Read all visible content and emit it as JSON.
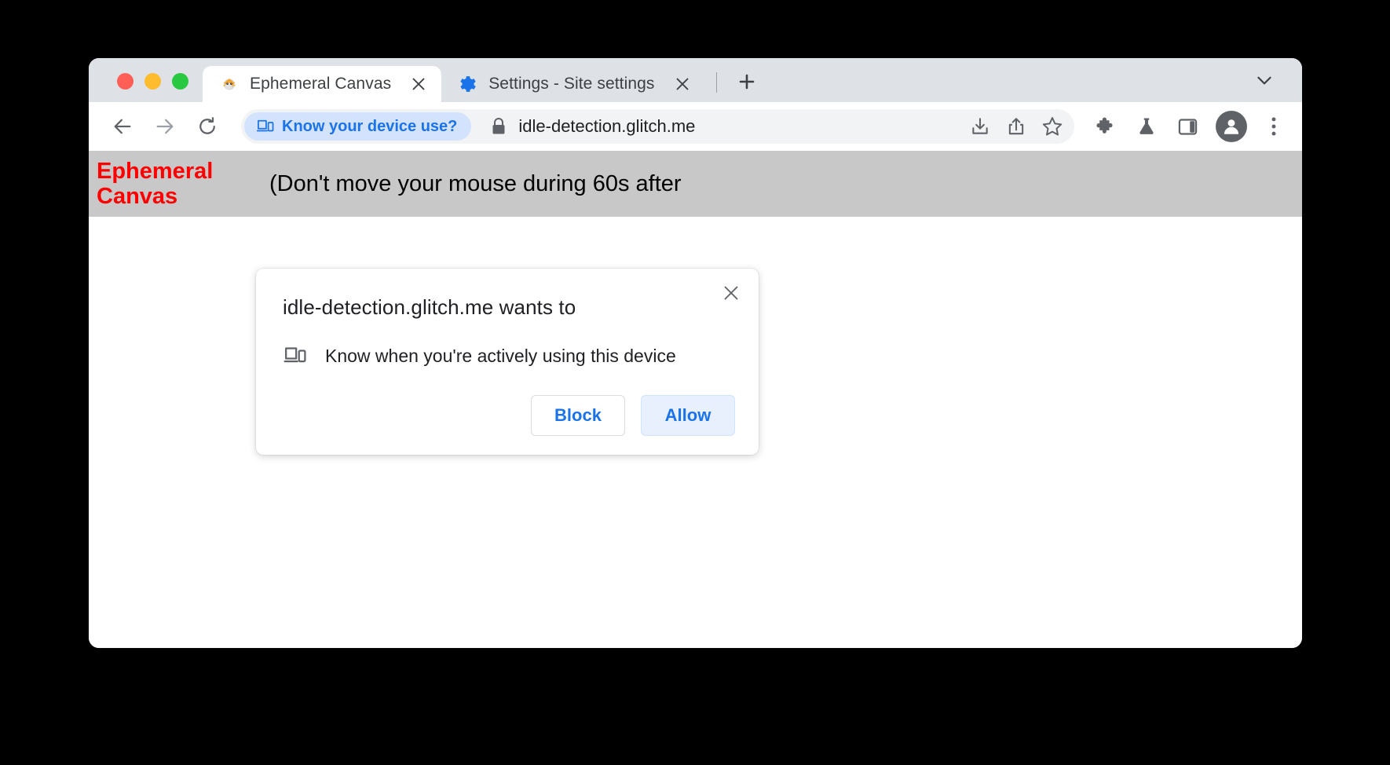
{
  "window": {
    "traffic_lights": [
      {
        "name": "close",
        "color": "#ff5f57"
      },
      {
        "name": "minimize",
        "color": "#febc2e"
      },
      {
        "name": "zoom",
        "color": "#28c840"
      }
    ]
  },
  "tabs": [
    {
      "title": "Ephemeral Canvas",
      "favicon": "blowfish-icon",
      "active": true,
      "close_icon": "close-icon"
    },
    {
      "title": "Settings - Site settings",
      "favicon": "gear-icon",
      "active": false,
      "close_icon": "close-icon"
    }
  ],
  "tabstrip": {
    "new_tab_icon": "plus-icon",
    "chevron_icon": "chevron-down-icon"
  },
  "toolbar": {
    "back_icon": "arrow-left-icon",
    "forward_icon": "arrow-right-icon",
    "reload_icon": "reload-icon",
    "chip": {
      "label": "Know your device use?",
      "icon": "device-idle-icon",
      "bg": "#d3e3fd",
      "fg": "#1a73e8"
    },
    "lock_icon": "lock-icon",
    "url": "idle-detection.glitch.me",
    "actions": [
      {
        "name": "download-icon"
      },
      {
        "name": "share-icon"
      },
      {
        "name": "bookmark-star-icon"
      }
    ],
    "extras": [
      {
        "name": "extensions-puzzle-icon"
      },
      {
        "name": "experiments-flask-icon"
      },
      {
        "name": "side-panel-icon"
      }
    ],
    "avatar_icon": "profile-avatar-icon",
    "menu_icon": "three-dot-menu-icon"
  },
  "page": {
    "heading": "Ephemeral Canvas",
    "heading_color": "#ff0000",
    "banner_bg": "#c8c8c8",
    "body_text": "(Don't move your mouse during 60s after"
  },
  "permission_bubble": {
    "title": "idle-detection.glitch.me wants to",
    "close_icon": "close-icon",
    "permission": {
      "icon": "device-idle-icon",
      "label": "Know when you're actively using this device"
    },
    "buttons": [
      {
        "label": "Block",
        "style": "secondary"
      },
      {
        "label": "Allow",
        "style": "primary"
      }
    ]
  }
}
